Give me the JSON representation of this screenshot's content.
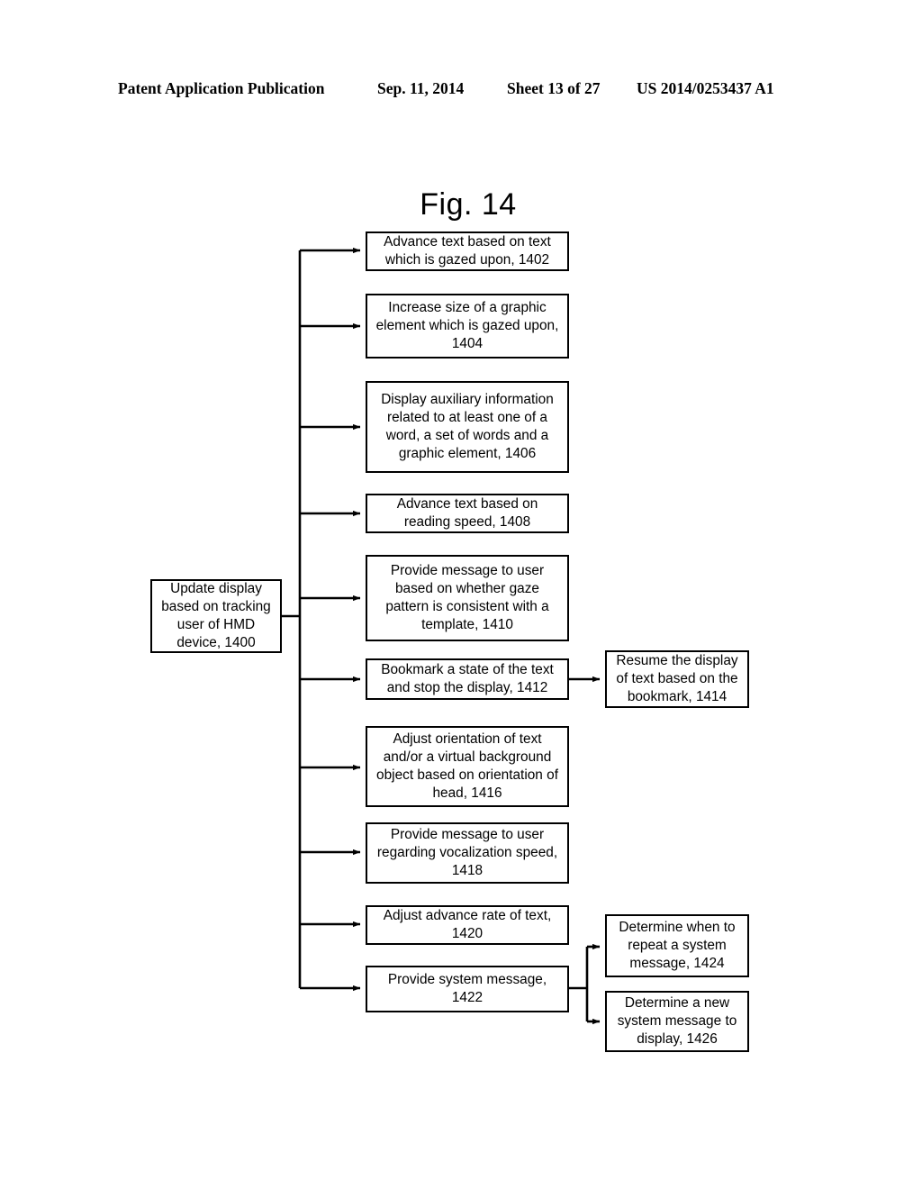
{
  "header": {
    "publication": "Patent Application Publication",
    "date": "Sep. 11, 2014",
    "sheet": "Sheet 13 of 27",
    "patent_number": "US 2014/0253437 A1"
  },
  "figure": {
    "label": "Fig. 14",
    "type": "flowchart",
    "line_color": "#000000",
    "background_color": "#ffffff"
  },
  "flowchart": {
    "root": {
      "id": "1400",
      "text": "Update display based on tracking user of HMD device, 1400"
    },
    "branches": [
      {
        "id": "1402",
        "text": "Advance text based on text which is gazed upon, 1402"
      },
      {
        "id": "1404",
        "text": "Increase size of a graphic element which is gazed upon, 1404"
      },
      {
        "id": "1406",
        "text": "Display auxiliary information related to at least one of a word, a set of words and a graphic element, 1406"
      },
      {
        "id": "1408",
        "text": "Advance text based on reading speed, 1408"
      },
      {
        "id": "1410",
        "text": "Provide message to user based on whether gaze pattern is consistent with a template, 1410"
      },
      {
        "id": "1412",
        "text": "Bookmark a state of the text and stop the display, 1412"
      },
      {
        "id": "1416",
        "text": "Adjust orientation of text and/or a virtual background object based on orientation of head, 1416"
      },
      {
        "id": "1418",
        "text": "Provide message to user regarding vocalization speed, 1418"
      },
      {
        "id": "1420",
        "text": "Adjust advance rate of text, 1420"
      },
      {
        "id": "1422",
        "text": "Provide system message, 1422"
      }
    ],
    "sub_branches": [
      {
        "id": "1414",
        "text": "Resume the display of text based on the bookmark, 1414",
        "from": "1412"
      },
      {
        "id": "1424",
        "text": "Determine when to repeat a system message, 1424",
        "from": "1422"
      },
      {
        "id": "1426",
        "text": "Determine a new system message to display, 1426",
        "from": "1422"
      }
    ]
  }
}
